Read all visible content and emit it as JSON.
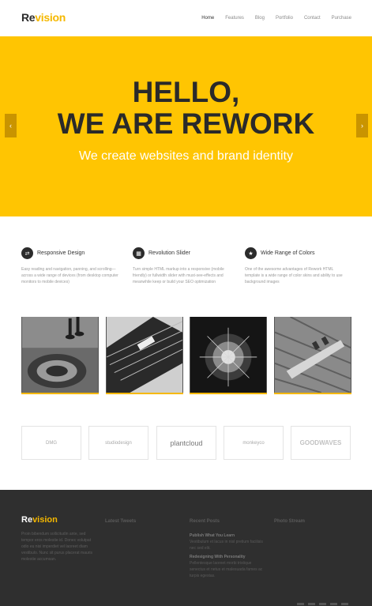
{
  "header": {
    "logo_part1": "Re",
    "logo_part2": "vision",
    "nav": [
      "Home",
      "Features",
      "Blog",
      "Portfolio",
      "Contact",
      "Purchase"
    ]
  },
  "hero": {
    "line1": "HELLO,",
    "line2": "WE ARE REWORK",
    "subtitle": "We create websites and brand identity",
    "prev_arrow": "‹",
    "next_arrow": "›"
  },
  "features": [
    {
      "icon": "⇄",
      "title": "Responsive Design",
      "text": "Easy reading and navigation, panning, and scrolling—across a wide range of devices (from desktop computer monitors to mobile devices)"
    },
    {
      "icon": "▦",
      "title": "Revolution Slider",
      "text": "Turn simple HTML markup into a responsive (mobile friendly) or fullwidth slider with must-see-effects and meanwhile keep or build your SEO optimization"
    },
    {
      "icon": "★",
      "title": "Wide Range of Colors",
      "text": "One of the awesome advantages of Rework HTML template is a wide range of color skins and ability to use background images"
    }
  ],
  "clients": [
    "DMG",
    "studiodesign",
    "plantcloud",
    "monkeyco",
    "GOODWAVES"
  ],
  "footer": {
    "logo_part1": "Re",
    "logo_part2": "vision",
    "about": "Proin bibendum sollicitudin ante, sed tempor eros molestie id. Donec volutpat odio eu nisi imperdiet vel laoreet diam vestibulo. Nunc sit purus placerat mauris molestie accumsan.",
    "tweets_heading": "Latest Tweets",
    "posts_heading": "Recent Posts",
    "photos_heading": "Photo Stream",
    "posts": [
      {
        "title": "Publish What You Learn",
        "text": "Vestibulum et lacus in nisl pretium facilisis nec sed elit."
      },
      {
        "title": "Redesigning With Personality",
        "text": "Pellentesque laoreet morbi tristique senectus et netus et malesuada fames ac turpis egestas."
      }
    ]
  }
}
